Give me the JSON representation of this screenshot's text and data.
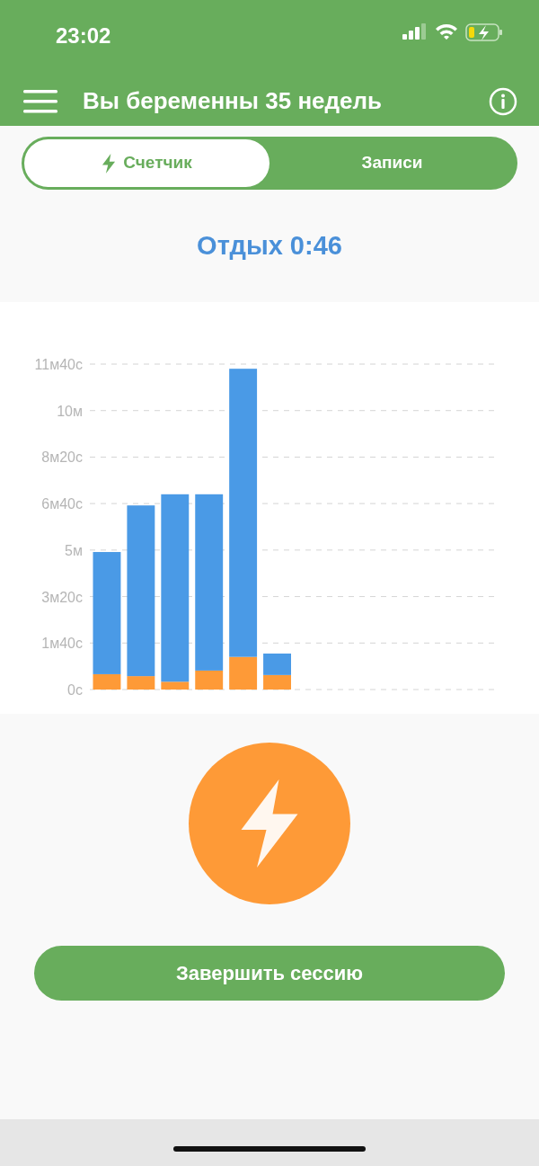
{
  "status_bar": {
    "time": "23:02"
  },
  "app_bar": {
    "title": "Вы беременны 35 недель"
  },
  "tabs": [
    {
      "label": "Счетчик",
      "selected": true
    },
    {
      "label": "Записи",
      "selected": false
    }
  ],
  "timer": {
    "text": "Отдых 0:46"
  },
  "chart": {
    "chart_data": {
      "type": "bar",
      "stacked": true,
      "grid": true,
      "categories": [
        null,
        null,
        null,
        null,
        null,
        null
      ],
      "ylim": [
        0,
        11.667
      ],
      "yticks": [
        {
          "value": 0,
          "label": "0с"
        },
        {
          "value": 1.667,
          "label": "1м40с"
        },
        {
          "value": 3.333,
          "label": "3м20с"
        },
        {
          "value": 5,
          "label": "5м"
        },
        {
          "value": 6.667,
          "label": "6м40с"
        },
        {
          "value": 8.333,
          "label": "8м20с"
        },
        {
          "value": 10,
          "label": "10м"
        },
        {
          "value": 11.667,
          "label": "11м40с"
        }
      ],
      "series": [
        {
          "color": "#fe9a37",
          "values": [
            0.55,
            0.48,
            0.28,
            0.68,
            1.17,
            0.52
          ]
        },
        {
          "color": "#4a9ae6",
          "values": [
            4.38,
            6.12,
            6.72,
            6.32,
            10.33,
            0.77
          ]
        }
      ]
    }
  },
  "action_button": {
    "kind": "bolt"
  },
  "end_button": {
    "label": "Завершить сессию"
  }
}
